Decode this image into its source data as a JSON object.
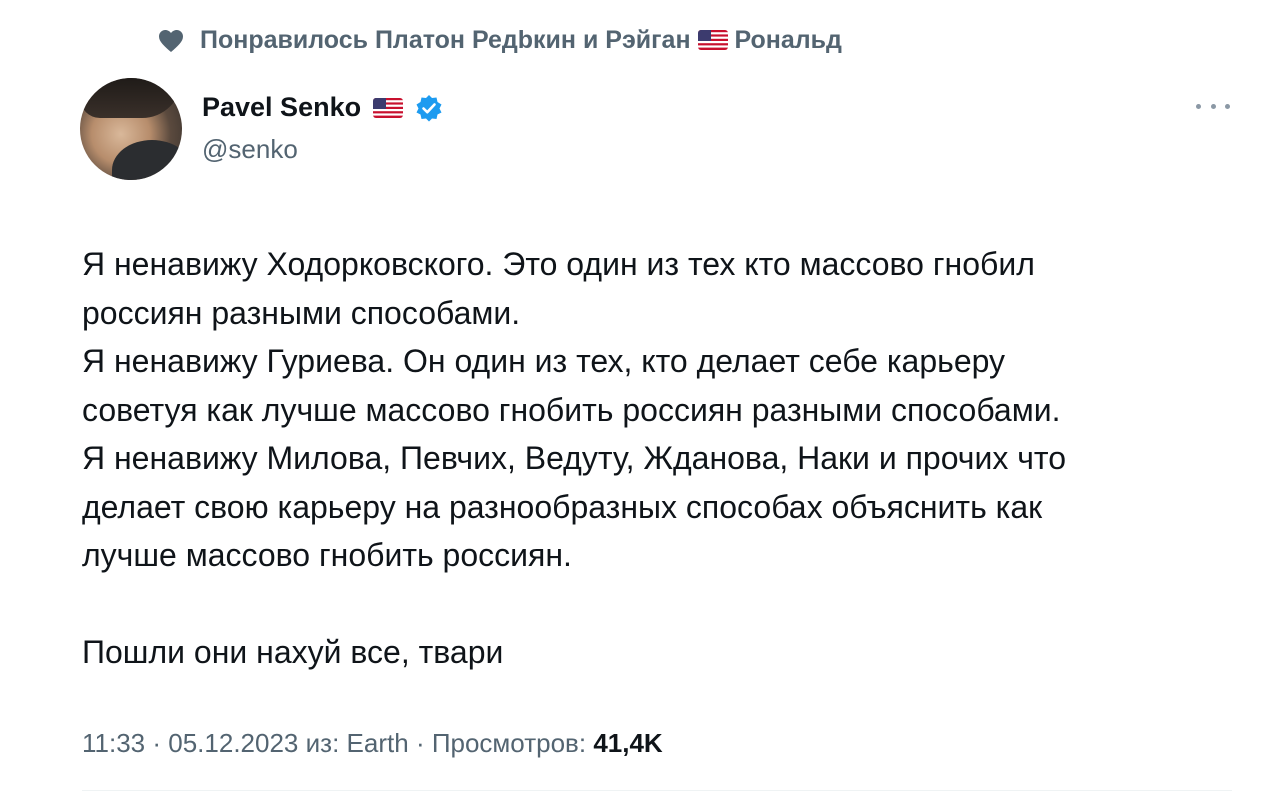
{
  "social_context": {
    "icon": "heart-icon",
    "prefix": "Понравилось Платон Редbкин и Рэйган",
    "suffix": "Рональд"
  },
  "author": {
    "name": "Pavel Senko",
    "handle": "@senko",
    "verified_color": "#1d9bf0"
  },
  "tweet": {
    "lines": [
      "Я ненавижу Ходорковского. Это один из тех кто массово гнобил",
      "россиян разными способами.",
      "Я ненавижу Гуриева. Он один из тех, кто делает себе карьеру",
      "советуя как лучше массово гнобить россиян разными способами.",
      "Я ненавижу Милова, Певчих, Ведуту, Жданова, Наки и прочих что",
      "делает свою карьеру на разнообразных способах объяснить как",
      "лучше массово гнобить россиян."
    ],
    "closing": "Пошли они нахуй все, твари"
  },
  "meta": {
    "time": "11:33",
    "date": "05.12.2023",
    "source_prefix": "из:",
    "source": "Earth",
    "views_label": "Просмотров:",
    "views_count": "41,4K"
  },
  "colors": {
    "text_primary": "#0f1419",
    "text_secondary": "#536471",
    "accent": "#1d9bf0"
  }
}
